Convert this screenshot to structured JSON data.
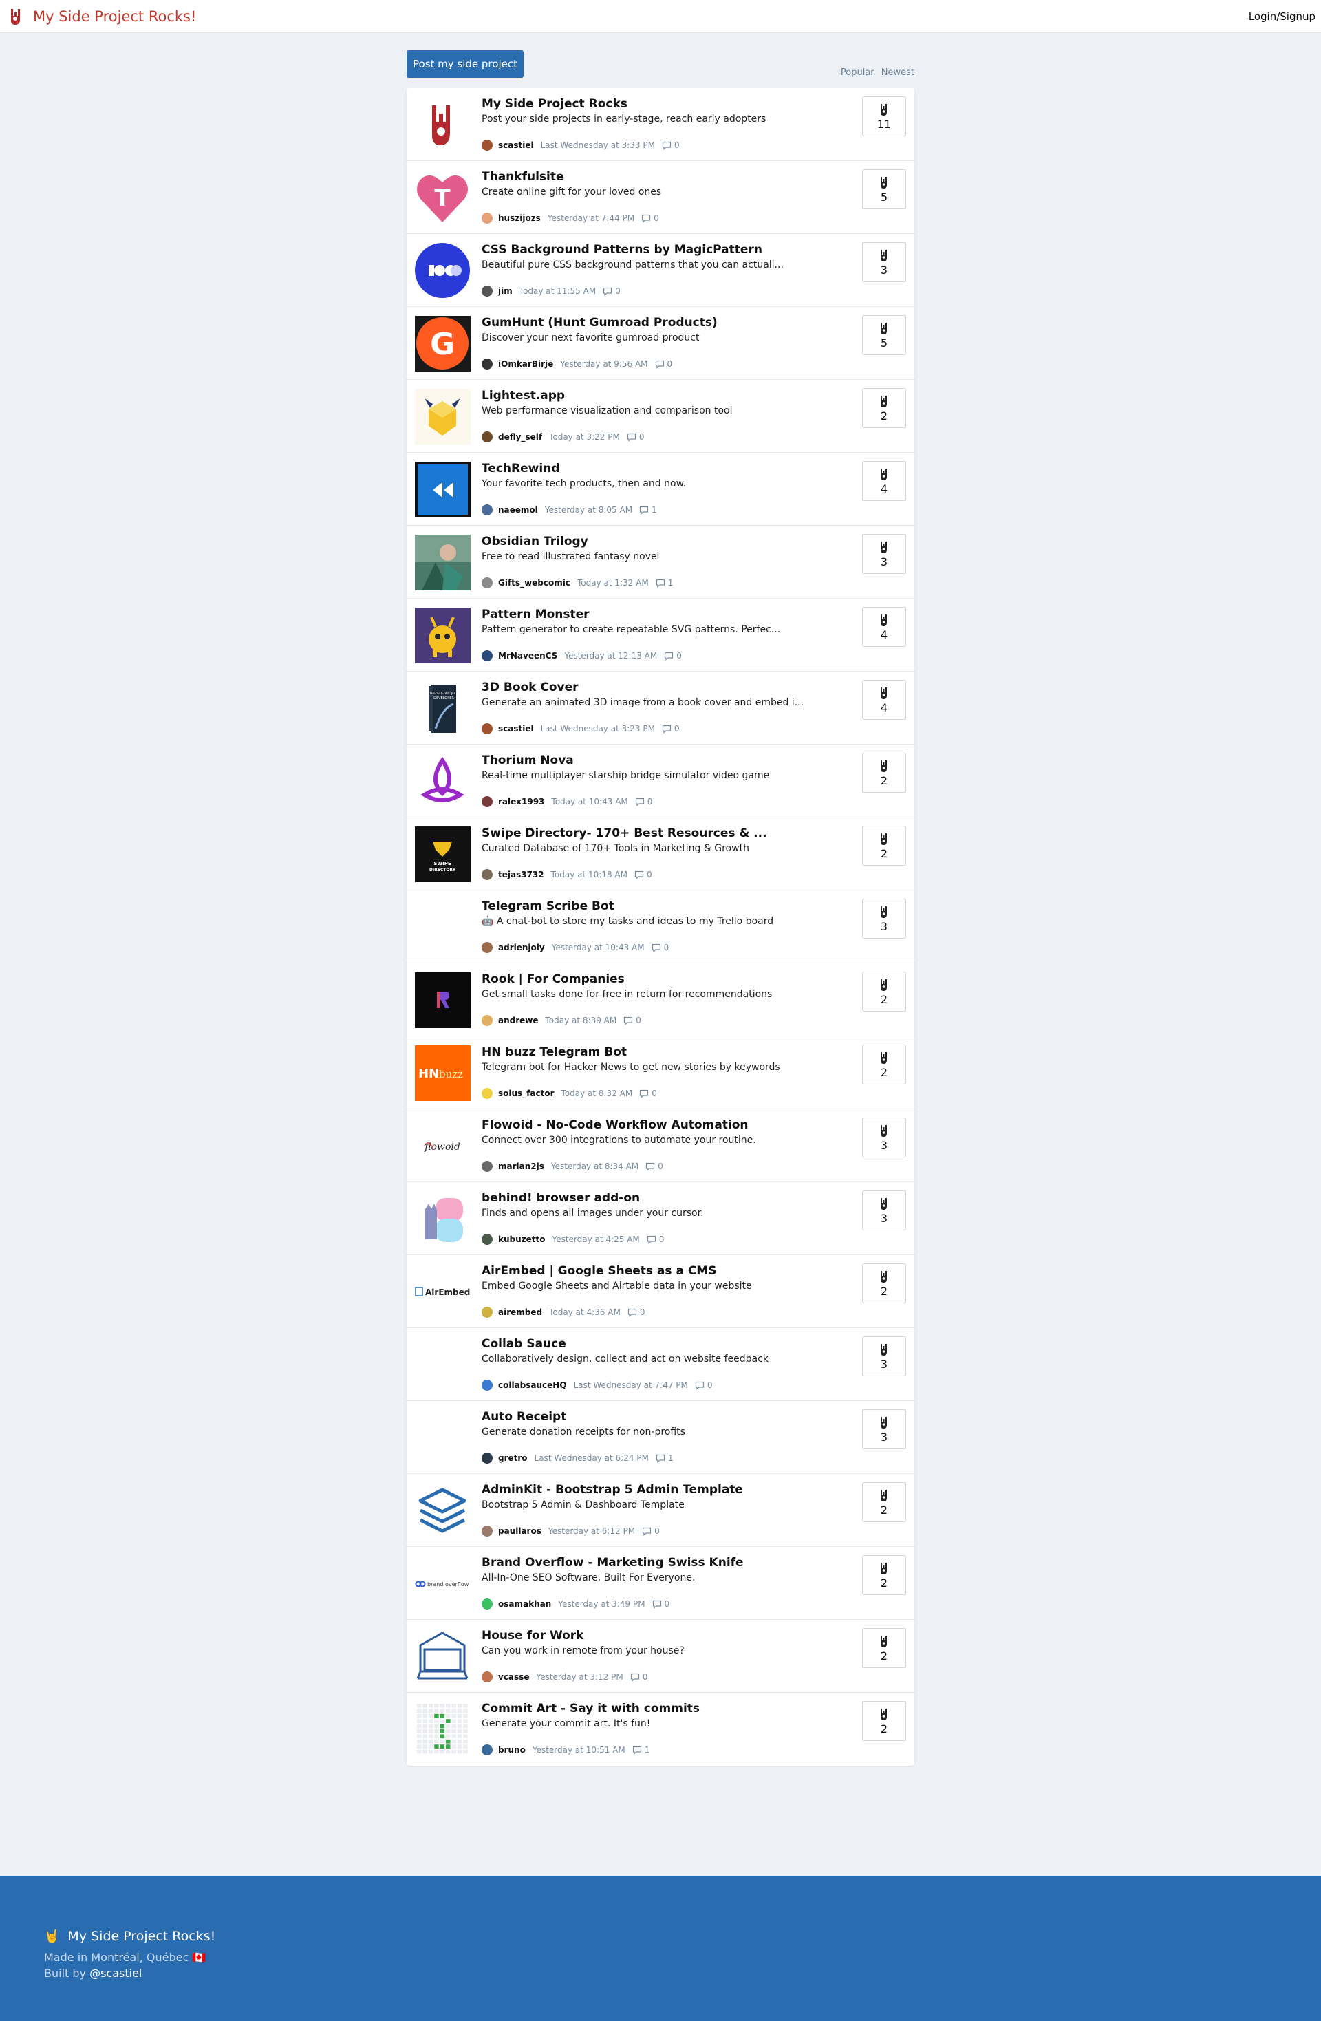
{
  "header": {
    "site_name": "My Side Project Rocks!",
    "login_label": "Login/Signup"
  },
  "toolbar": {
    "post_label": "Post my side project",
    "sort_popular": "Popular",
    "sort_newest": "Newest"
  },
  "projects": [
    {
      "title": "My Side Project Rocks",
      "description": "Post your side projects in early-stage, reach early adopters",
      "author": "scastiel",
      "time": "Last Wednesday at 3:33 PM",
      "comments": "0",
      "votes": "11",
      "thumb": "rock-hand",
      "avatar_color": "#a0522d"
    },
    {
      "title": "Thankfulsite",
      "description": "Create online gift for your loved ones",
      "author": "huszijozs",
      "time": "Yesterday at 7:44 PM",
      "comments": "0",
      "votes": "5",
      "thumb": "heart-t",
      "avatar_color": "#e8a07a"
    },
    {
      "title": "CSS Background Patterns by MagicPattern",
      "description": "Beautiful pure CSS background patterns that you can actuall...",
      "author": "jim",
      "time": "Today at 11:55 AM",
      "comments": "0",
      "votes": "3",
      "thumb": "magicpattern",
      "avatar_color": "#555555"
    },
    {
      "title": "GumHunt (Hunt Gumroad Products)",
      "description": "Discover your next favorite gumroad product",
      "author": "iOmkarBirje",
      "time": "Yesterday at 9:56 AM",
      "comments": "0",
      "votes": "5",
      "thumb": "gumhunt",
      "avatar_color": "#333333"
    },
    {
      "title": "Lightest.app",
      "description": "Web performance visualization and comparison tool",
      "author": "defly_self",
      "time": "Today at 3:22 PM",
      "comments": "0",
      "votes": "2",
      "thumb": "lightest",
      "avatar_color": "#6b4a2a"
    },
    {
      "title": "TechRewind",
      "description": "Your favorite tech products, then and now.",
      "author": "naeemol",
      "time": "Yesterday at 8:05 AM",
      "comments": "1",
      "votes": "4",
      "thumb": "techrewind",
      "avatar_color": "#4a6a9a"
    },
    {
      "title": "Obsidian Trilogy",
      "description": "Free to read illustrated fantasy novel",
      "author": "Gifts_webcomic",
      "time": "Today at 1:32 AM",
      "comments": "1",
      "votes": "3",
      "thumb": "obsidian",
      "avatar_color": "#8a8a8a"
    },
    {
      "title": "Pattern Monster",
      "description": "Pattern generator to create repeatable SVG patterns. Perfec...",
      "author": "MrNaveenCS",
      "time": "Yesterday at 12:13 AM",
      "comments": "0",
      "votes": "4",
      "thumb": "patternmonster",
      "avatar_color": "#2a4a7a"
    },
    {
      "title": "3D Book Cover",
      "description": "Generate an animated 3D image from a book cover and embed i...",
      "author": "scastiel",
      "time": "Last Wednesday at 3:23 PM",
      "comments": "0",
      "votes": "4",
      "thumb": "bookcover",
      "avatar_color": "#a0522d"
    },
    {
      "title": "Thorium Nova",
      "description": "Real-time multiplayer starship bridge simulator video game",
      "author": "ralex1993",
      "time": "Today at 10:43 AM",
      "comments": "0",
      "votes": "2",
      "thumb": "thorium",
      "avatar_color": "#7a3a3a"
    },
    {
      "title": "Swipe Directory- 170+ Best Resources & ...",
      "description": "Curated Database of 170+ Tools in Marketing & Growth",
      "author": "tejas3732",
      "time": "Today at 10:18 AM",
      "comments": "0",
      "votes": "2",
      "thumb": "swipe",
      "avatar_color": "#7a6a5a"
    },
    {
      "title": "Telegram Scribe Bot",
      "description": "🤖 A chat-bot to store my tasks and ideas to my Trello board",
      "author": "adrienjoly",
      "time": "Yesterday at 10:43 AM",
      "comments": "0",
      "votes": "3",
      "thumb": "none",
      "avatar_color": "#9a6a4a"
    },
    {
      "title": "Rook | For Companies",
      "description": "Get small tasks done for free in return for recommendations",
      "author": "andrewe",
      "time": "Today at 8:39 AM",
      "comments": "0",
      "votes": "2",
      "thumb": "rook",
      "avatar_color": "#e0b060"
    },
    {
      "title": "HN buzz Telegram Bot",
      "description": "Telegram bot for Hacker News to get new stories by keywords",
      "author": "solus_factor",
      "time": "Today at 8:32 AM",
      "comments": "0",
      "votes": "2",
      "thumb": "hnbuzz",
      "avatar_color": "#f0d040"
    },
    {
      "title": "Flowoid - No-Code Workflow Automation",
      "description": "Connect over 300 integrations to automate your routine.",
      "author": "marian2js",
      "time": "Yesterday at 8:34 AM",
      "comments": "0",
      "votes": "3",
      "thumb": "flowoid",
      "avatar_color": "#6a6a6a"
    },
    {
      "title": "behind! browser add-on",
      "description": "Finds and opens all images under your cursor.",
      "author": "kubuzetto",
      "time": "Yesterday at 4:25 AM",
      "comments": "0",
      "votes": "3",
      "thumb": "behind",
      "avatar_color": "#4a5a4a"
    },
    {
      "title": "AirEmbed | Google Sheets as a CMS",
      "description": "Embed Google Sheets and Airtable data in your website",
      "author": "airembed",
      "time": "Today at 4:36 AM",
      "comments": "0",
      "votes": "2",
      "thumb": "airembed",
      "avatar_color": "#d0b040"
    },
    {
      "title": "Collab Sauce",
      "description": "Collaboratively design, collect and act on website feedback",
      "author": "collabsauceHQ",
      "time": "Last Wednesday at 7:47 PM",
      "comments": "0",
      "votes": "3",
      "thumb": "none",
      "avatar_color": "#3a7ad0"
    },
    {
      "title": "Auto Receipt",
      "description": "Generate donation receipts for non-profits",
      "author": "gretro",
      "time": "Last Wednesday at 6:24 PM",
      "comments": "1",
      "votes": "3",
      "thumb": "none",
      "avatar_color": "#2a3a4a"
    },
    {
      "title": "AdminKit - Bootstrap 5 Admin Template",
      "description": "Bootstrap 5 Admin & Dashboard Template",
      "author": "paullaros",
      "time": "Yesterday at 6:12 PM",
      "comments": "0",
      "votes": "2",
      "thumb": "adminkit",
      "avatar_color": "#9a7a6a"
    },
    {
      "title": "Brand Overflow - Marketing Swiss Knife",
      "description": "All-In-One SEO Software, Built For Everyone.",
      "author": "osamakhan",
      "time": "Yesterday at 3:49 PM",
      "comments": "0",
      "votes": "2",
      "thumb": "brandoverflow",
      "avatar_color": "#3ac060"
    },
    {
      "title": "House for Work",
      "description": "Can you work in remote from your house?",
      "author": "vcasse",
      "time": "Yesterday at 3:12 PM",
      "comments": "0",
      "votes": "2",
      "thumb": "house",
      "avatar_color": "#c0704a"
    },
    {
      "title": "Commit Art - Say it with commits",
      "description": "Generate your commit art. It's fun!",
      "author": "bruno",
      "time": "Yesterday at 10:51 AM",
      "comments": "1",
      "votes": "2",
      "thumb": "commitart",
      "avatar_color": "#3a6a9a"
    }
  ],
  "thumb_texts": {
    "heart_letter": "T",
    "gumhunt_letter": "G",
    "hnbuzz_hn": "HN",
    "hnbuzz_buzz": "buzz",
    "airembed": "AirEmbed",
    "flowoid": "flowoid",
    "brandoverflow": "brand overflow",
    "swipe_line1": "SWIPE",
    "swipe_line2": "DIRECTORY",
    "book_line1": "THE SIDE PROJECT",
    "book_line2": "DEVELOPER"
  },
  "footer": {
    "brand": "My Side Project Rocks!",
    "made_in": "Made in Montréal, Québec 🇨🇦",
    "built_by_prefix": "Built by ",
    "built_by_link": "@scastiel"
  }
}
